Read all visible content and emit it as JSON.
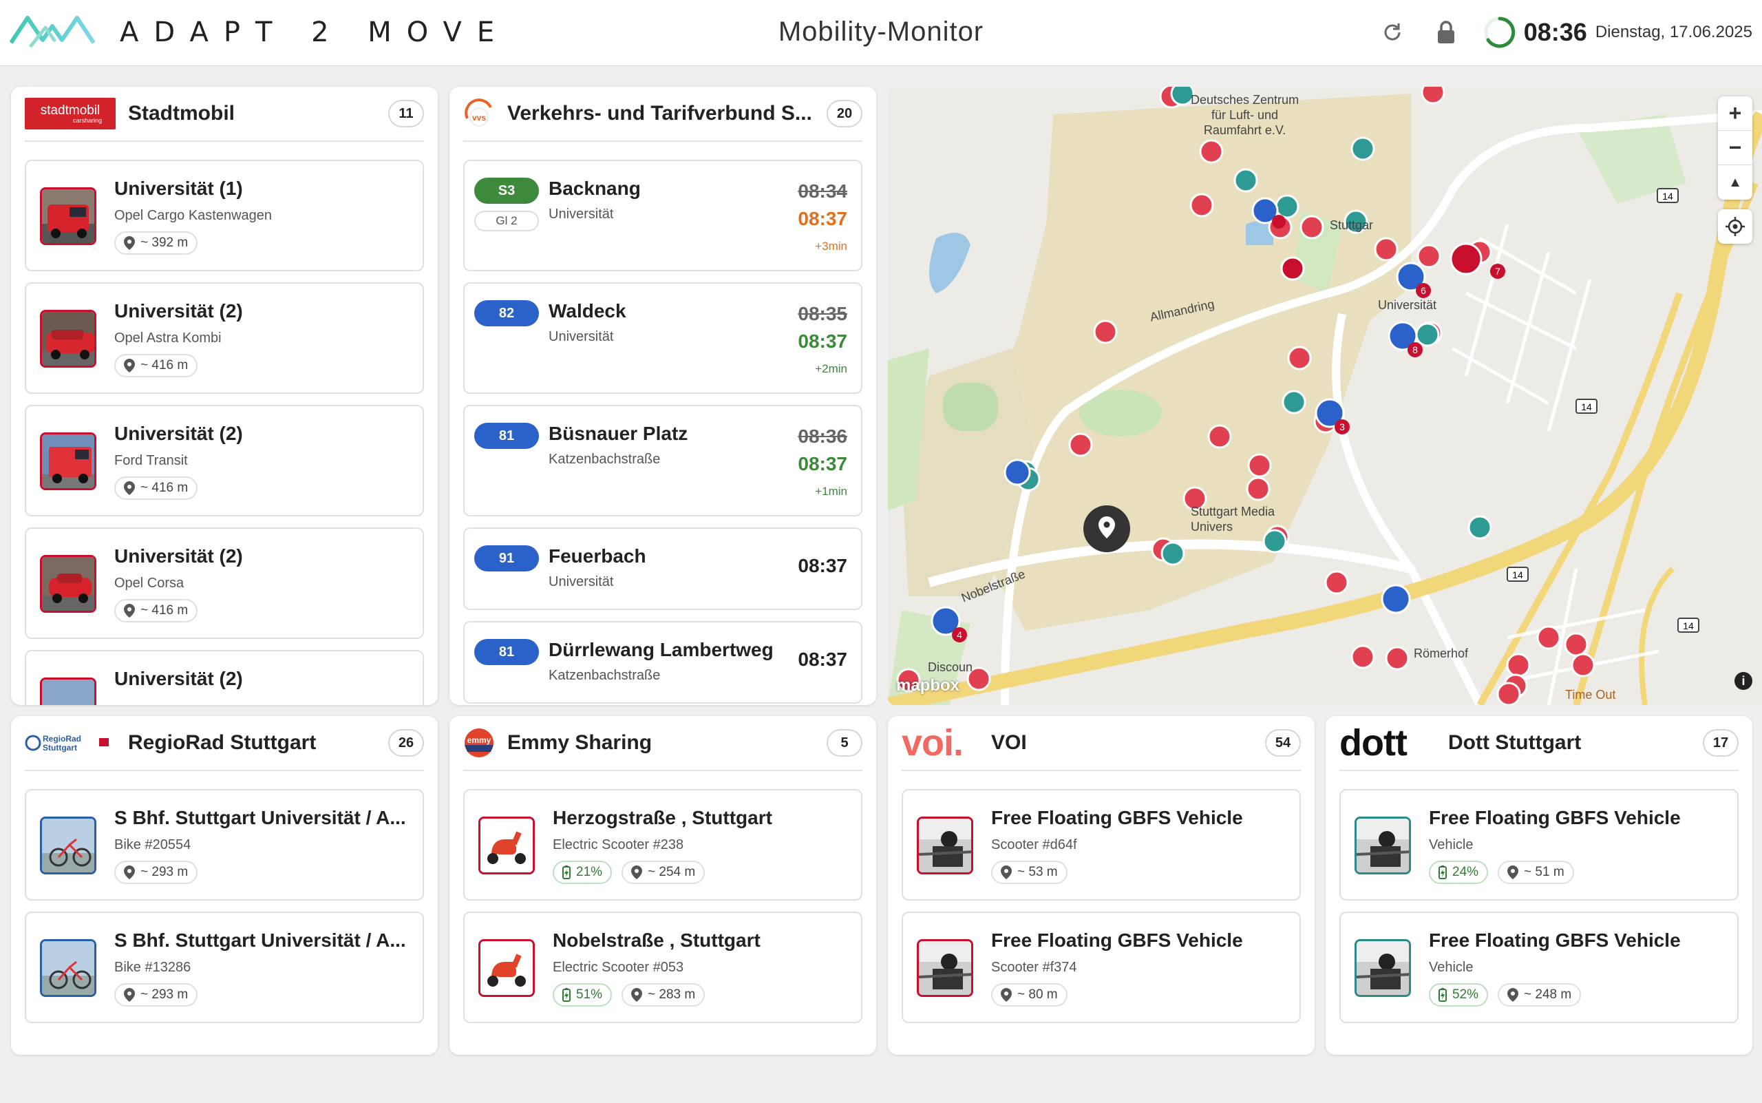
{
  "header": {
    "logo_text": "ADAPT 2 MOVE",
    "title": "Mobility-Monitor",
    "time": "08:36",
    "date": "Dienstag, 17.06.2025",
    "icons": [
      "refresh-icon",
      "lock-icon",
      "progress-ring-icon"
    ]
  },
  "stadtmobil": {
    "brand": "stadtmobil",
    "brand_sub": "carsharing",
    "title": "Stadtmobil",
    "count": "11",
    "items": [
      {
        "title": "Universität (1)",
        "sub": "Opel Cargo Kastenwagen",
        "dist": "~ 392 m"
      },
      {
        "title": "Universität (2)",
        "sub": "Opel Astra Kombi",
        "dist": "~ 416 m"
      },
      {
        "title": "Universität (2)",
        "sub": "Ford Transit",
        "dist": "~ 416 m"
      },
      {
        "title": "Universität (2)",
        "sub": "Opel Corsa",
        "dist": "~ 416 m"
      },
      {
        "title": "Universität (2)",
        "sub": "",
        "dist": ""
      }
    ]
  },
  "vvs": {
    "brand": "vvs",
    "title": "Verkehrs- und Tarifverbund S...",
    "count": "20",
    "departures": [
      {
        "line": "S3",
        "color": "#3d8a3d",
        "gleis": "Gl 2",
        "dest": "Backnang",
        "stop": "Universität",
        "planned": "08:34",
        "real": "08:37",
        "delay": "+3min",
        "delay_color": "orange"
      },
      {
        "line": "82",
        "color": "#2a62c9",
        "gleis": "",
        "dest": "Waldeck",
        "stop": "Universität",
        "planned": "08:35",
        "real": "08:37",
        "delay": "+2min",
        "delay_color": "green"
      },
      {
        "line": "81",
        "color": "#2a62c9",
        "gleis": "",
        "dest": "Büsnauer Platz",
        "stop": "Katzenbachstraße",
        "planned": "08:36",
        "real": "08:37",
        "delay": "+1min",
        "delay_color": "green"
      },
      {
        "line": "91",
        "color": "#2a62c9",
        "gleis": "",
        "dest": "Feuerbach",
        "stop": "Universität",
        "planned": "08:37",
        "real": "",
        "delay": "",
        "delay_color": ""
      },
      {
        "line": "81",
        "color": "#2a62c9",
        "gleis": "",
        "dest": "Dürrlewang Lambertweg",
        "stop": "Katzenbachstraße",
        "planned": "08:37",
        "real": "",
        "delay": "",
        "delay_color": ""
      }
    ]
  },
  "map": {
    "labels": {
      "dlr": "Deutsches Zentrum\nfür Luft- und\nRaumfahrt e.V.",
      "stuttgart": "Stuttgar",
      "uni": "Universität",
      "allmandring": "Allmandring",
      "media": "Stuttgart Media\nUnivers",
      "nobel": "Nobelstraße",
      "roemerhof": "Römerhof",
      "timeout": "Time Out",
      "discount": "Discoun",
      "road14": "14"
    },
    "attribution": "mapbox",
    "zoom_in": "+",
    "zoom_out": "−",
    "compass": "▲",
    "info": "i"
  },
  "regiorad": {
    "brand": "RegioRad Stuttgart",
    "title": "RegioRad Stuttgart",
    "count": "26",
    "items": [
      {
        "title": "S Bhf. Stuttgart Universität / A...",
        "sub": "Bike #20554",
        "dist": "~ 293 m"
      },
      {
        "title": "S Bhf. Stuttgart Universität / A...",
        "sub": "Bike #13286",
        "dist": "~ 293 m"
      }
    ]
  },
  "emmy": {
    "brand": "emmy",
    "title": "Emmy Sharing",
    "count": "5",
    "items": [
      {
        "title": "Herzogstraße , Stuttgart",
        "sub": "Electric Scooter #238",
        "battery": "21%",
        "dist": "~ 254 m"
      },
      {
        "title": "Nobelstraße , Stuttgart",
        "sub": "Electric Scooter #053",
        "battery": "51%",
        "dist": "~ 283 m"
      }
    ]
  },
  "voi": {
    "brand": "voi.",
    "title": "VOI",
    "count": "54",
    "items": [
      {
        "title": "Free Floating GBFS Vehicle",
        "sub": "Scooter #d64f",
        "dist": "~ 53 m"
      },
      {
        "title": "Free Floating GBFS Vehicle",
        "sub": "Scooter #f374",
        "dist": "~ 80 m"
      }
    ]
  },
  "dott": {
    "brand": "dott",
    "title": "Dott Stuttgart",
    "count": "17",
    "items": [
      {
        "title": "Free Floating GBFS Vehicle",
        "sub": "Vehicle",
        "battery": "24%",
        "dist": "~ 51 m"
      },
      {
        "title": "Free Floating GBFS Vehicle",
        "sub": "Vehicle",
        "battery": "52%",
        "dist": "~ 248 m"
      }
    ]
  },
  "colors": {
    "accent_red": "#c8102e",
    "green": "#3a8a3a",
    "orange": "#e07020",
    "blue": "#2a62c9",
    "teal": "#2a8a86",
    "marker_red": "#e04050",
    "marker_teal": "#2e9a94"
  }
}
